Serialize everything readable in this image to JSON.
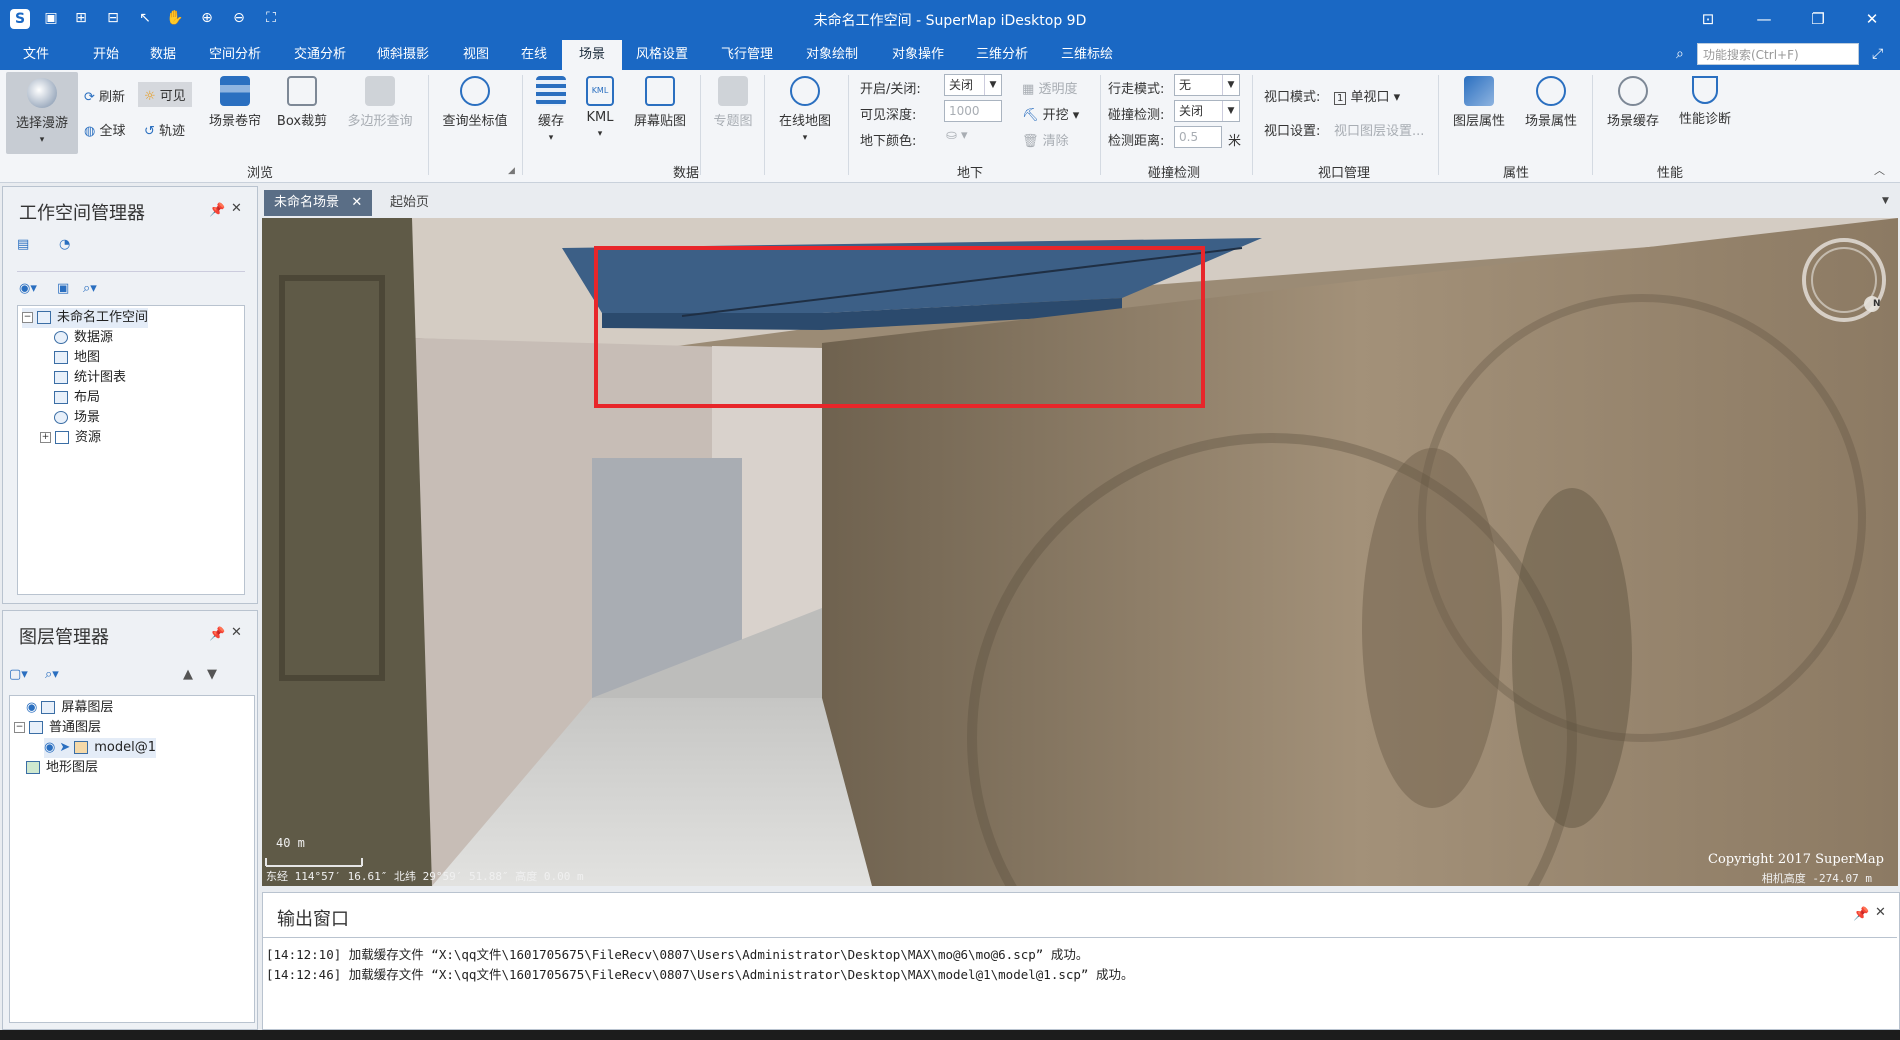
{
  "window": {
    "title": "未命名工作空间 - SuperMap iDesktop 9D"
  },
  "menu": {
    "tabs": [
      "文件",
      "开始",
      "数据",
      "空间分析",
      "交通分析",
      "倾斜摄影",
      "视图",
      "在线",
      "场景",
      "风格设置",
      "飞行管理",
      "对象绘制",
      "对象操作",
      "三维分析",
      "三维标绘"
    ],
    "active": "场景",
    "search_placeholder": "功能搜索(Ctrl+F)"
  },
  "ribbon": {
    "browse": {
      "select_roam": "选择漫游",
      "refresh": "刷新",
      "visible": "可见",
      "globe": "全球",
      "track": "轨迹",
      "scene_curtain": "场景卷帘",
      "box_clip": "Box裁剪",
      "polygon_query": "多边形查询",
      "query_coord": "查询坐标值",
      "group": "浏览"
    },
    "data": {
      "cache": "缓存",
      "kml": "KML",
      "screen_paste": "屏幕贴图",
      "thematic": "专题图",
      "online_map": "在线地图",
      "group": "数据"
    },
    "underground": {
      "onoff_label": "开启/关闭:",
      "onoff_value": "关闭",
      "depth_label": "可见深度:",
      "depth_value": "1000",
      "color_label": "地下颜色:",
      "transparency": "透明度",
      "excavate": "开挖",
      "clear": "清除",
      "group": "地下"
    },
    "collision": {
      "walk_label": "行走模式:",
      "walk_value": "无",
      "detect_label": "碰撞检测:",
      "detect_value": "关闭",
      "distance_label": "检测距离:",
      "distance_value": "0.5",
      "unit": "米",
      "group": "碰撞检测"
    },
    "viewport": {
      "mode_label": "视口模式:",
      "mode_value": "单视口",
      "settings_label": "视口设置:",
      "settings_value": "视口图层设置...",
      "group": "视口管理"
    },
    "props": {
      "layer_props": "图层属性",
      "scene_props": "场景属性",
      "group": "属性"
    },
    "perf": {
      "scene_cache": "场景缓存",
      "perf_diag": "性能诊断",
      "group": "性能"
    }
  },
  "workspace_panel": {
    "title": "工作空间管理器",
    "root": "未命名工作空间",
    "items": [
      "数据源",
      "地图",
      "统计图表",
      "布局",
      "场景",
      "资源"
    ]
  },
  "layer_panel": {
    "title": "图层管理器",
    "items": [
      "屏幕图层",
      "普通图层",
      "model@1",
      "地形图层"
    ]
  },
  "doc_tabs": [
    "未命名场景",
    "起始页"
  ],
  "scene": {
    "scale": "40 m",
    "status_left": "东经 114°57′ 16.61″  北纬 29°59′ 51.88″  高度 0.00 m",
    "copyright": "Copyright 2017 SuperMap",
    "camera_height": "相机高度 -274.07 m",
    "compass_letter": "N",
    "highlight_color": "#e8262a"
  },
  "output": {
    "title": "输出窗口",
    "lines": [
      "[14:12:10] 加载缓存文件 “X:\\qq文件\\1601705675\\FileRecv\\0807\\Users\\Administrator\\Desktop\\MAX\\mo@6\\mo@6.scp” 成功。",
      "[14:12:46] 加载缓存文件 “X:\\qq文件\\1601705675\\FileRecv\\0807\\Users\\Administrator\\Desktop\\MAX\\model@1\\model@1.scp” 成功。"
    ]
  }
}
